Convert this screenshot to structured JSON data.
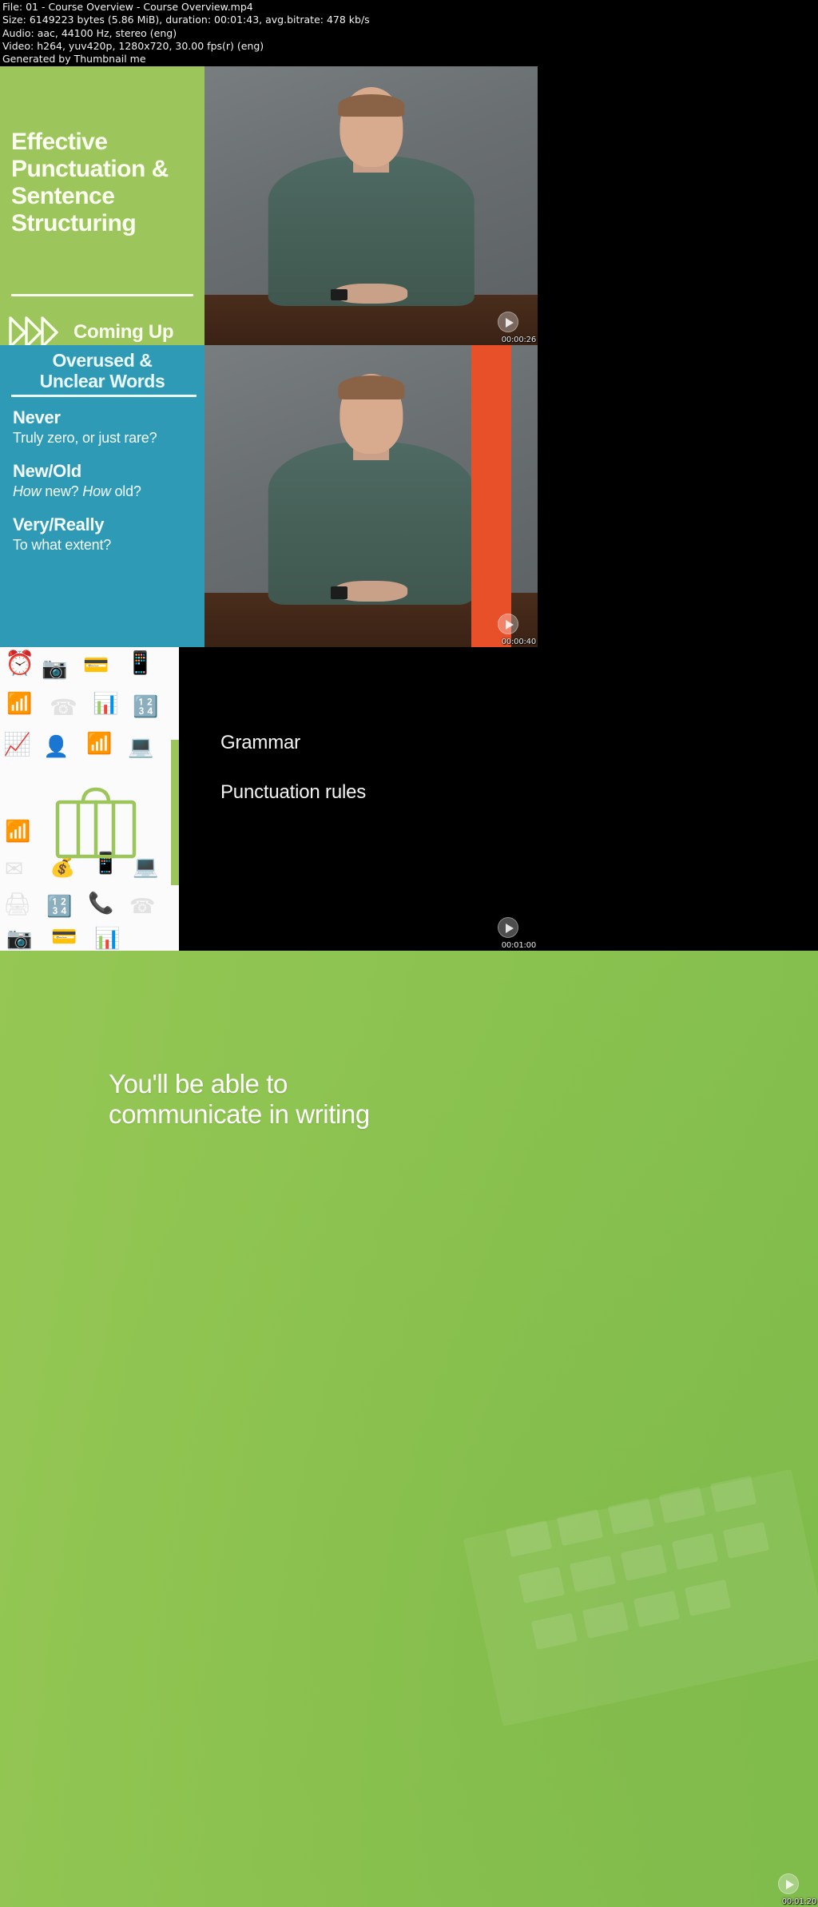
{
  "header": {
    "lines": [
      "File: 01 - Course Overview - Course Overview.mp4",
      "Size: 6149223 bytes (5.86 MiB), duration: 00:01:43, avg.bitrate: 478 kb/s",
      "Audio: aac, 44100 Hz, stereo (eng)",
      "Video: h264, yuv420p, 1280x720, 30.00 fps(r) (eng)",
      "Generated by Thumbnail me"
    ]
  },
  "slides": {
    "title_slide": {
      "title": "Effective Punctuation & Sentence Structuring",
      "coming_up_label": "Coming Up",
      "chevron_icon": "triple-chevron-right-icon",
      "bg_color": "#9cc65c"
    },
    "overused_slide": {
      "heading_line1": "Overused &",
      "heading_line2": "Unclear Words",
      "bg_color": "#2e9ab5",
      "items": [
        {
          "term": "Never",
          "question": "Truly zero, or just rare?"
        },
        {
          "term": "New/Old",
          "question_html": "<em>How</em> new? <em>How</em> old?"
        },
        {
          "term": "Very/Really",
          "question": "To what extent?"
        }
      ]
    },
    "pattern_slide": {
      "icon": "suitcase-icon",
      "accent_color": "#9cc65c"
    },
    "bullets_slide": {
      "bg_color": "#000000",
      "items": [
        "Grammar",
        "Punctuation rules"
      ]
    },
    "wide_slide": {
      "text_line1": "You'll be able to",
      "text_line2": "communicate in writing",
      "bg_color": "#8cbb50"
    }
  },
  "thumbnails": [
    {
      "timestamp": "00:00:26",
      "play_icon": "play-badge-icon"
    },
    {
      "timestamp": "00:00:40",
      "play_icon": "play-badge-icon"
    },
    {
      "timestamp": "00:01:00",
      "play_icon": "play-badge-icon"
    },
    {
      "timestamp": "00:01:20",
      "play_icon": "play-badge-icon"
    }
  ]
}
